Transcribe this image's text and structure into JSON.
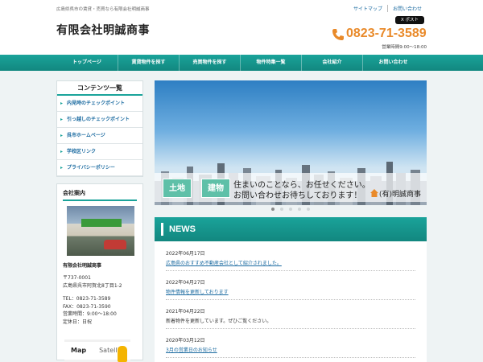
{
  "header": {
    "tagline": "広島県呉市の賃貸・売買なら有限会社明誠商事",
    "links": [
      "サイトマップ",
      "お問い合わせ"
    ],
    "post_button": "X ポスト",
    "site_title": "有限会社明誠商事",
    "phone": "0823-71-3589",
    "hours": "営業時間9:00～18:00"
  },
  "nav": {
    "items": [
      "トップページ",
      "賃貸物件を探す",
      "売買物件を探す",
      "物件特集一覧",
      "会社紹介",
      "お問い合わせ"
    ]
  },
  "sidebar": {
    "contents_title": "コンテンツ一覧",
    "items": [
      "内見時のチェックポイント",
      "引っ越しのチェックポイント",
      "呉市ホームページ",
      "学校区リンク",
      "プライバシーポリシー"
    ],
    "company": {
      "title": "会社案内",
      "name": "有限会社明誠商事",
      "postal": "〒737-0001",
      "address": "広島県呉市阿賀北8丁目1-2",
      "tel": "TEL：0823-71-3589",
      "fax": "FAX：0823-71-3590",
      "hours": "営業時間：9:00～18:00",
      "holiday": "定休日：日祝",
      "map_buttons": [
        "Map",
        "Satellite"
      ]
    }
  },
  "hero": {
    "tags": [
      "土地",
      "建物"
    ],
    "caption_line1": "住まいのことなら、お任せください。",
    "caption_line2": "お問い合わせお待ちしております！",
    "caption_company": "(有)明誠商事",
    "slide_count": 5,
    "active_slide": 0
  },
  "news": {
    "title": "NEWS",
    "items": [
      {
        "date": "2022年06月17日",
        "text": "広島県のおすすめ不動産会社として紹介されました。",
        "link": true
      },
      {
        "date": "2022年04月27日",
        "text": "物件情報を更新しております",
        "link": true
      },
      {
        "date": "2021年04月22日",
        "text": "新着物件を更新しています。ぜひご覧ください。",
        "link": false
      },
      {
        "date": "2020年03月12日",
        "text": "3月の営業日のお知らせ",
        "link": true
      }
    ]
  },
  "colors": {
    "accent": "#1aa39a",
    "phone": "#e98a2a",
    "link": "#1a6aa0"
  }
}
